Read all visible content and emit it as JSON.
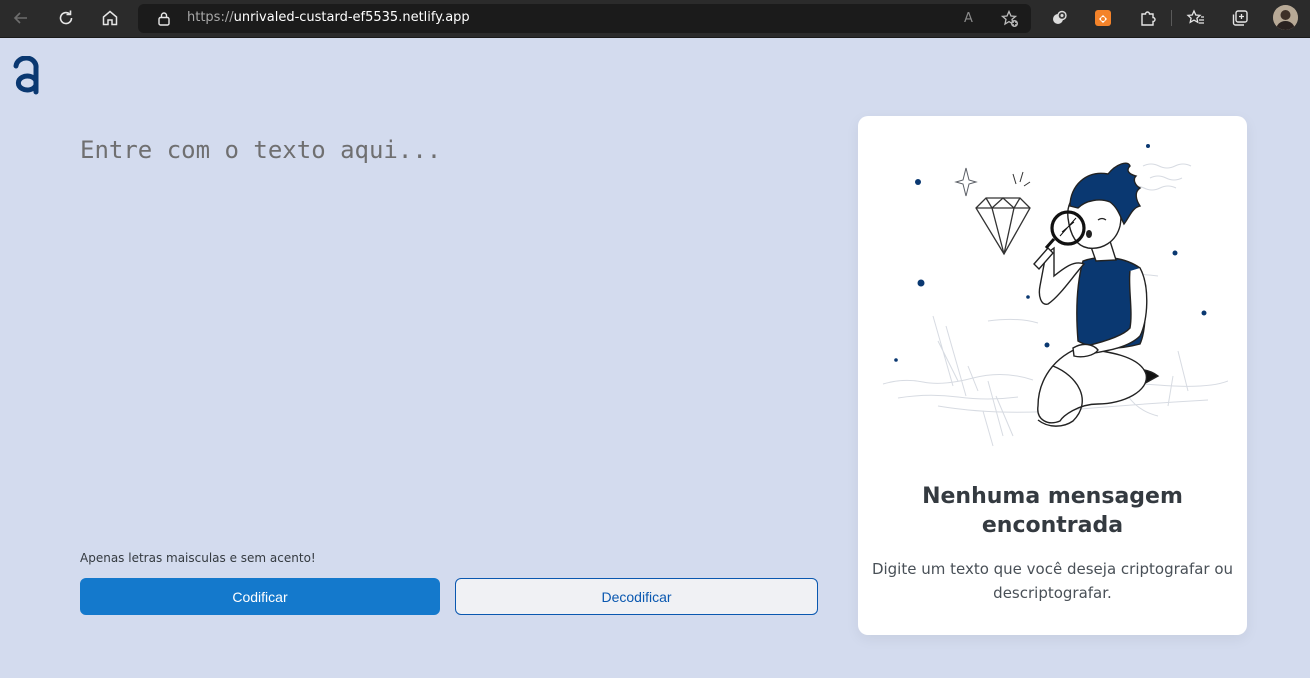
{
  "browser": {
    "url_scheme": "https://",
    "url_host": "unrivaled-custard-ef5535.netlify.app",
    "read_aloud_label": "A",
    "icons": [
      "back-icon",
      "reload-icon",
      "home-icon",
      "lock-icon",
      "read-aloud-icon",
      "add-favorite-icon",
      "extension-icon",
      "extensions-icon",
      "favorites-icon",
      "collections-icon",
      "profile-avatar"
    ]
  },
  "app": {
    "logo_letter": "a",
    "input": {
      "placeholder": "Entre com o texto aqui...",
      "value": ""
    },
    "hint": "Apenas letras maisculas e sem acento!",
    "encode_button": "Codificar",
    "decode_button": "Decodificar"
  },
  "result": {
    "title": "Nenhuma mensagem encontrada",
    "description": "Digite um texto que você deseja criptografar ou descriptografar."
  },
  "colors": {
    "background": "#d3dbee",
    "primary": "#1479cc",
    "dark_blue": "#0a3871",
    "card": "#ffffff"
  }
}
